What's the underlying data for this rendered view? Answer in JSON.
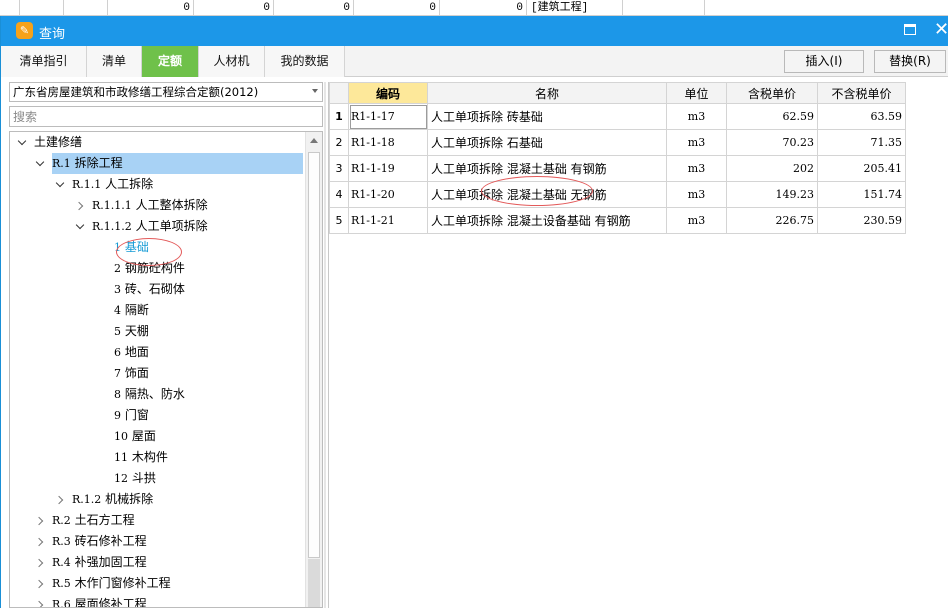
{
  "background_sheet": {
    "cells": [
      "0",
      "0",
      "0",
      "0",
      "0",
      "[建筑工程]"
    ]
  },
  "window": {
    "title": "查询"
  },
  "tabs": [
    {
      "label": "清单指引",
      "active": false
    },
    {
      "label": "清单",
      "active": false
    },
    {
      "label": "定额",
      "active": true
    },
    {
      "label": "人材机",
      "active": false
    },
    {
      "label": "我的数据",
      "active": false
    }
  ],
  "toolbar": {
    "insert_label": "插入(I)",
    "replace_label": "替换(R)"
  },
  "left": {
    "quota_select_value": "广东省房屋建筑和市政修缮工程综合定额(2012)",
    "search_placeholder": "搜索",
    "tree": [
      {
        "code": "",
        "label": "土建修缮",
        "state": "expanded"
      },
      {
        "code": "R.1",
        "label": "拆除工程",
        "state": "expanded",
        "selected": true
      },
      {
        "code": "R.1.1",
        "label": "人工拆除",
        "state": "expanded"
      },
      {
        "code": "R.1.1.1",
        "label": "人工整体拆除",
        "state": "collapsed"
      },
      {
        "code": "R.1.1.2",
        "label": "人工单项拆除",
        "state": "expanded"
      },
      {
        "code": "1",
        "label": "基础",
        "state": "leaf",
        "highlight": true
      },
      {
        "code": "2",
        "label": "钢筋砼构件",
        "state": "leaf"
      },
      {
        "code": "3",
        "label": "砖、石砌体",
        "state": "leaf"
      },
      {
        "code": "4",
        "label": "隔断",
        "state": "leaf"
      },
      {
        "code": "5",
        "label": "天棚",
        "state": "leaf"
      },
      {
        "code": "6",
        "label": "地面",
        "state": "leaf"
      },
      {
        "code": "7",
        "label": "饰面",
        "state": "leaf"
      },
      {
        "code": "8",
        "label": "隔热、防水",
        "state": "leaf"
      },
      {
        "code": "9",
        "label": "门窗",
        "state": "leaf"
      },
      {
        "code": "10",
        "label": "屋面",
        "state": "leaf"
      },
      {
        "code": "11",
        "label": "木构件",
        "state": "leaf"
      },
      {
        "code": "12",
        "label": "斗拱",
        "state": "leaf"
      },
      {
        "code": "R.1.2",
        "label": "机械拆除",
        "state": "collapsed"
      },
      {
        "code": "R.2",
        "label": "土石方工程",
        "state": "collapsed"
      },
      {
        "code": "R.3",
        "label": "砖石修补工程",
        "state": "collapsed"
      },
      {
        "code": "R.4",
        "label": "补强加固工程",
        "state": "collapsed"
      },
      {
        "code": "R.5",
        "label": "木作门窗修补工程",
        "state": "collapsed"
      },
      {
        "code": "R.6",
        "label": "屋面修补工程",
        "state": "collapsed"
      }
    ]
  },
  "grid": {
    "columns": [
      "编码",
      "名称",
      "单位",
      "含税单价",
      "不含税单价"
    ],
    "rows": [
      {
        "no": "1",
        "code": "R1-1-17",
        "name": "人工单项拆除 砖基础",
        "unit": "m3",
        "price_tax": "62.59",
        "price_notax": "63.59"
      },
      {
        "no": "2",
        "code": "R1-1-18",
        "name": "人工单项拆除 石基础",
        "unit": "m3",
        "price_tax": "70.23",
        "price_notax": "71.35"
      },
      {
        "no": "3",
        "code": "R1-1-19",
        "name": "人工单项拆除 混凝土基础 有钢筋",
        "unit": "m3",
        "price_tax": "202",
        "price_notax": "205.41"
      },
      {
        "no": "4",
        "code": "R1-1-20",
        "name": "人工单项拆除 混凝土基础 无钢筋",
        "unit": "m3",
        "price_tax": "149.23",
        "price_notax": "151.74"
      },
      {
        "no": "5",
        "code": "R1-1-21",
        "name": "人工单项拆除 混凝土设备基础 有钢筋",
        "unit": "m3",
        "price_tax": "226.75",
        "price_notax": "230.59"
      }
    ]
  }
}
